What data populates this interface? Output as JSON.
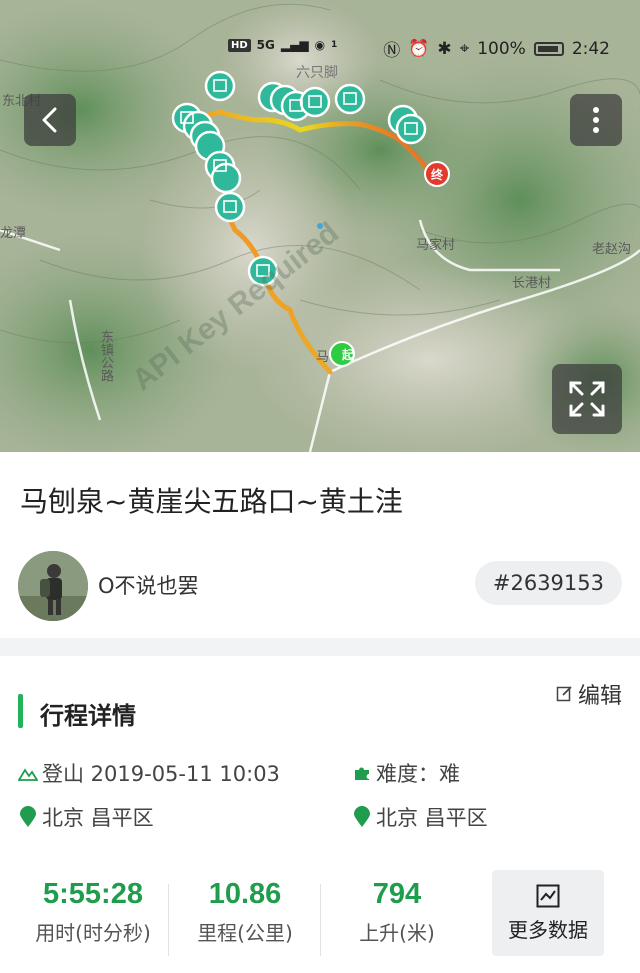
{
  "status_bar": {
    "left_items": [
      "HD",
      "5G",
      "1"
    ],
    "battery": "100%",
    "time": "2:42"
  },
  "map": {
    "place_labels": [
      "六只脚",
      "东北村",
      "龙潭",
      "马家村",
      "长港村",
      "老赵沟",
      "东镇公路",
      "马"
    ],
    "start_marker": "起",
    "end_marker": "终",
    "watermark": "API Key Required",
    "colors": {
      "route_start": "#e8d820",
      "route_end": "#e23b2e",
      "photo_marker": "#2fb99a"
    }
  },
  "route": {
    "title": "马刨泉~黄崖尖五路口~黄土洼",
    "username": "O不说也罢",
    "id": "#2639153"
  },
  "details": {
    "section_title": "行程详情",
    "edit_label": "编辑",
    "activity": "登山 2019-05-11 10:03",
    "difficulty": "难度：难",
    "start_location": "北京 昌平区",
    "end_location": "北京 昌平区",
    "start_badge": "起",
    "end_badge": "终",
    "accent_color": "#1f9d4c"
  },
  "stats": {
    "duration": {
      "value": "5:55:28",
      "label": "用时(时分秒)"
    },
    "distance": {
      "value": "10.86",
      "label": "里程(公里)"
    },
    "ascent": {
      "value": "794",
      "label": "上升(米)"
    },
    "more_label": "更多数据"
  }
}
